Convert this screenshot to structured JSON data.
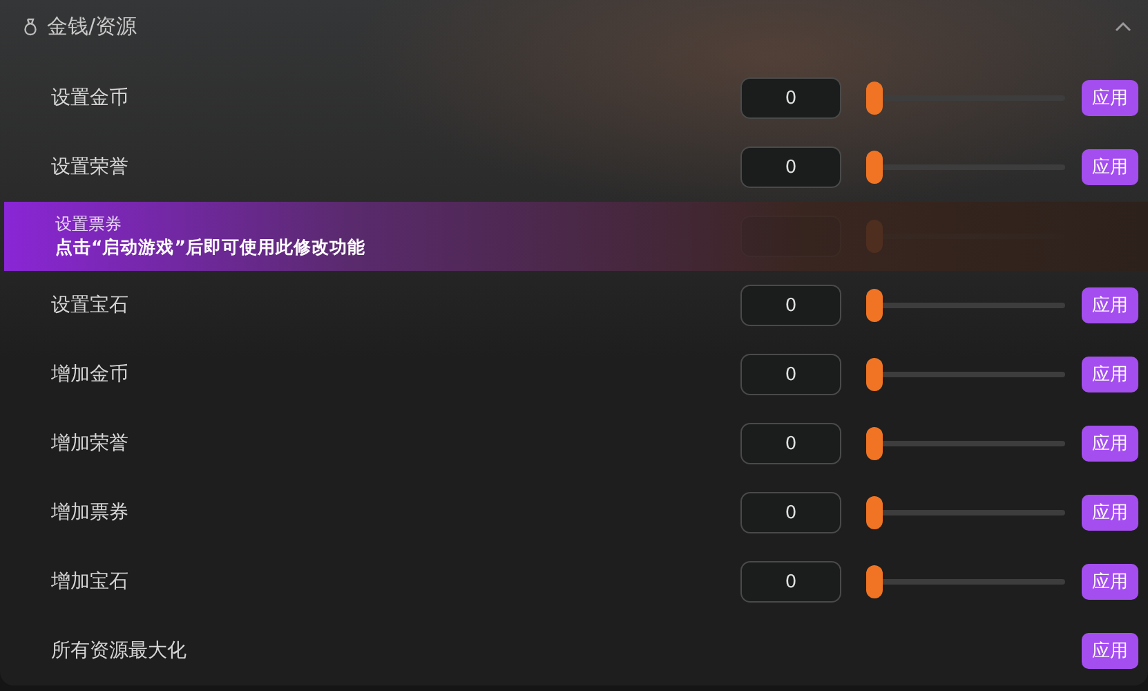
{
  "section": {
    "title": "金钱/资源",
    "expanded": true
  },
  "rows": [
    {
      "kind": "slider",
      "label": "设置金币",
      "value": "0",
      "level": 0,
      "button": "应用",
      "locked": false
    },
    {
      "kind": "slider",
      "label": "设置荣誉",
      "value": "0",
      "level": 0,
      "button": "应用",
      "locked": false
    },
    {
      "kind": "slider",
      "label": "设置票券",
      "level": 0,
      "locked": true,
      "notice": "点击“启动游戏”后即可使用此修改功能"
    },
    {
      "kind": "slider",
      "label": "设置宝石",
      "value": "0",
      "level": 0,
      "button": "应用",
      "locked": false
    },
    {
      "kind": "slider",
      "label": "增加金币",
      "value": "0",
      "level": 0,
      "button": "应用",
      "locked": false
    },
    {
      "kind": "slider",
      "label": "增加荣誉",
      "value": "0",
      "level": 0,
      "button": "应用",
      "locked": false
    },
    {
      "kind": "slider",
      "label": "增加票券",
      "value": "0",
      "level": 0,
      "button": "应用",
      "locked": false
    },
    {
      "kind": "slider",
      "label": "增加宝石",
      "value": "0",
      "level": 0,
      "button": "应用",
      "locked": false
    },
    {
      "kind": "action",
      "label": "所有资源最大化",
      "button": "应用",
      "locked": false
    }
  ]
}
